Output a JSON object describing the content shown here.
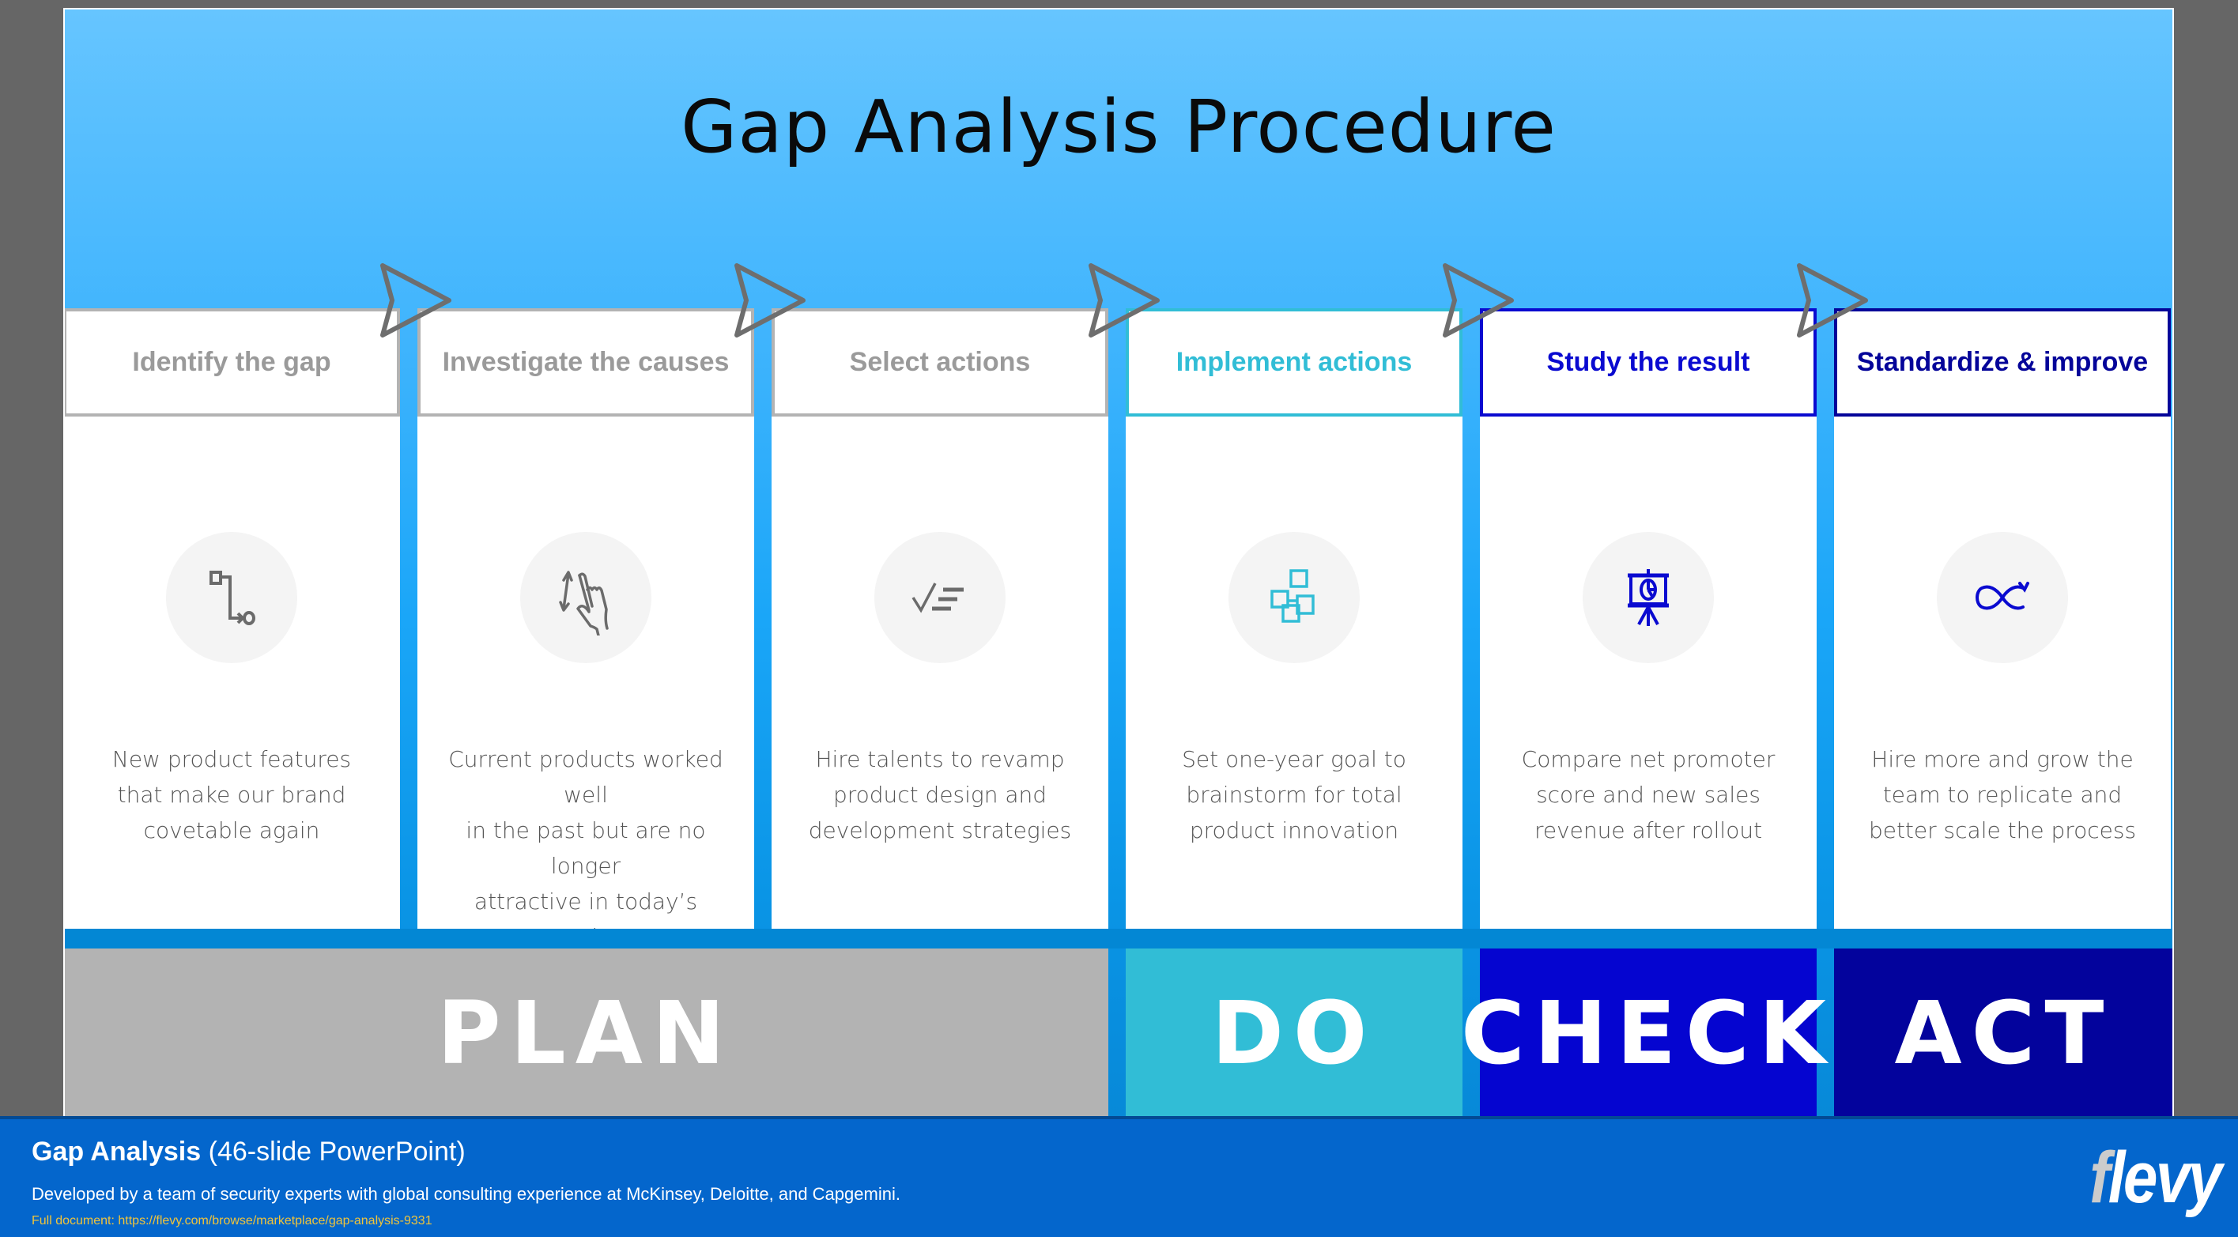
{
  "slide": {
    "title": "Gap Analysis Procedure"
  },
  "steps": [
    {
      "title": "Identify the gap",
      "icon": "path-flow-icon",
      "description_lines": [
        "New product features",
        "that make our brand",
        "covetable again"
      ],
      "color": "#9a9a9a",
      "border": "#b3b3b3"
    },
    {
      "title": "Investigate the causes",
      "icon": "hand-swipe-icon",
      "description_lines": [
        "Current products worked well",
        "in the past but are no longer",
        "attractive in today’s market"
      ],
      "color": "#9a9a9a",
      "border": "#b3b3b3"
    },
    {
      "title": "Select actions",
      "icon": "checklist-icon",
      "description_lines": [
        "Hire talents to revamp",
        "product design and",
        "development strategies"
      ],
      "color": "#9a9a9a",
      "border": "#b3b3b3"
    },
    {
      "title": "Implement actions",
      "icon": "sticky-notes-icon",
      "description_lines": [
        "Set one-year goal to",
        "brainstorm for total",
        "product innovation"
      ],
      "color": "#31bdd6",
      "border": "#31bdd6"
    },
    {
      "title": "Study the result",
      "icon": "presentation-chart-icon",
      "description_lines": [
        "Compare net promoter",
        "score and new sales",
        "revenue after rollout"
      ],
      "color": "#0a0ad0",
      "border": "#0a0ad0"
    },
    {
      "title": "Standardize & improve",
      "icon": "infinity-loop-icon",
      "description_lines": [
        "Hire more and grow the",
        "team to replicate and",
        "better scale the process"
      ],
      "color": "#040499",
      "border": "#040499"
    }
  ],
  "phases": [
    {
      "label": "PLAN",
      "color": "#b3b3b3",
      "span_steps": 3
    },
    {
      "label": "DO",
      "color": "#31bdd6",
      "span_steps": 1
    },
    {
      "label": "CHECK",
      "color": "#0505d0",
      "span_steps": 1
    },
    {
      "label": "ACT",
      "color": "#03039c",
      "span_steps": 1
    }
  ],
  "footer": {
    "title_bold": "Gap Analysis",
    "title_rest": " (46-slide PowerPoint)",
    "description": "Developed by a team of security experts with global consulting experience at McKinsey, Deloitte, and Capgemini.",
    "link_text": "Full document: https://flevy.com/browse/marketplace/gap-analysis-9331",
    "logo_first": "f",
    "logo_rest": "levy"
  }
}
